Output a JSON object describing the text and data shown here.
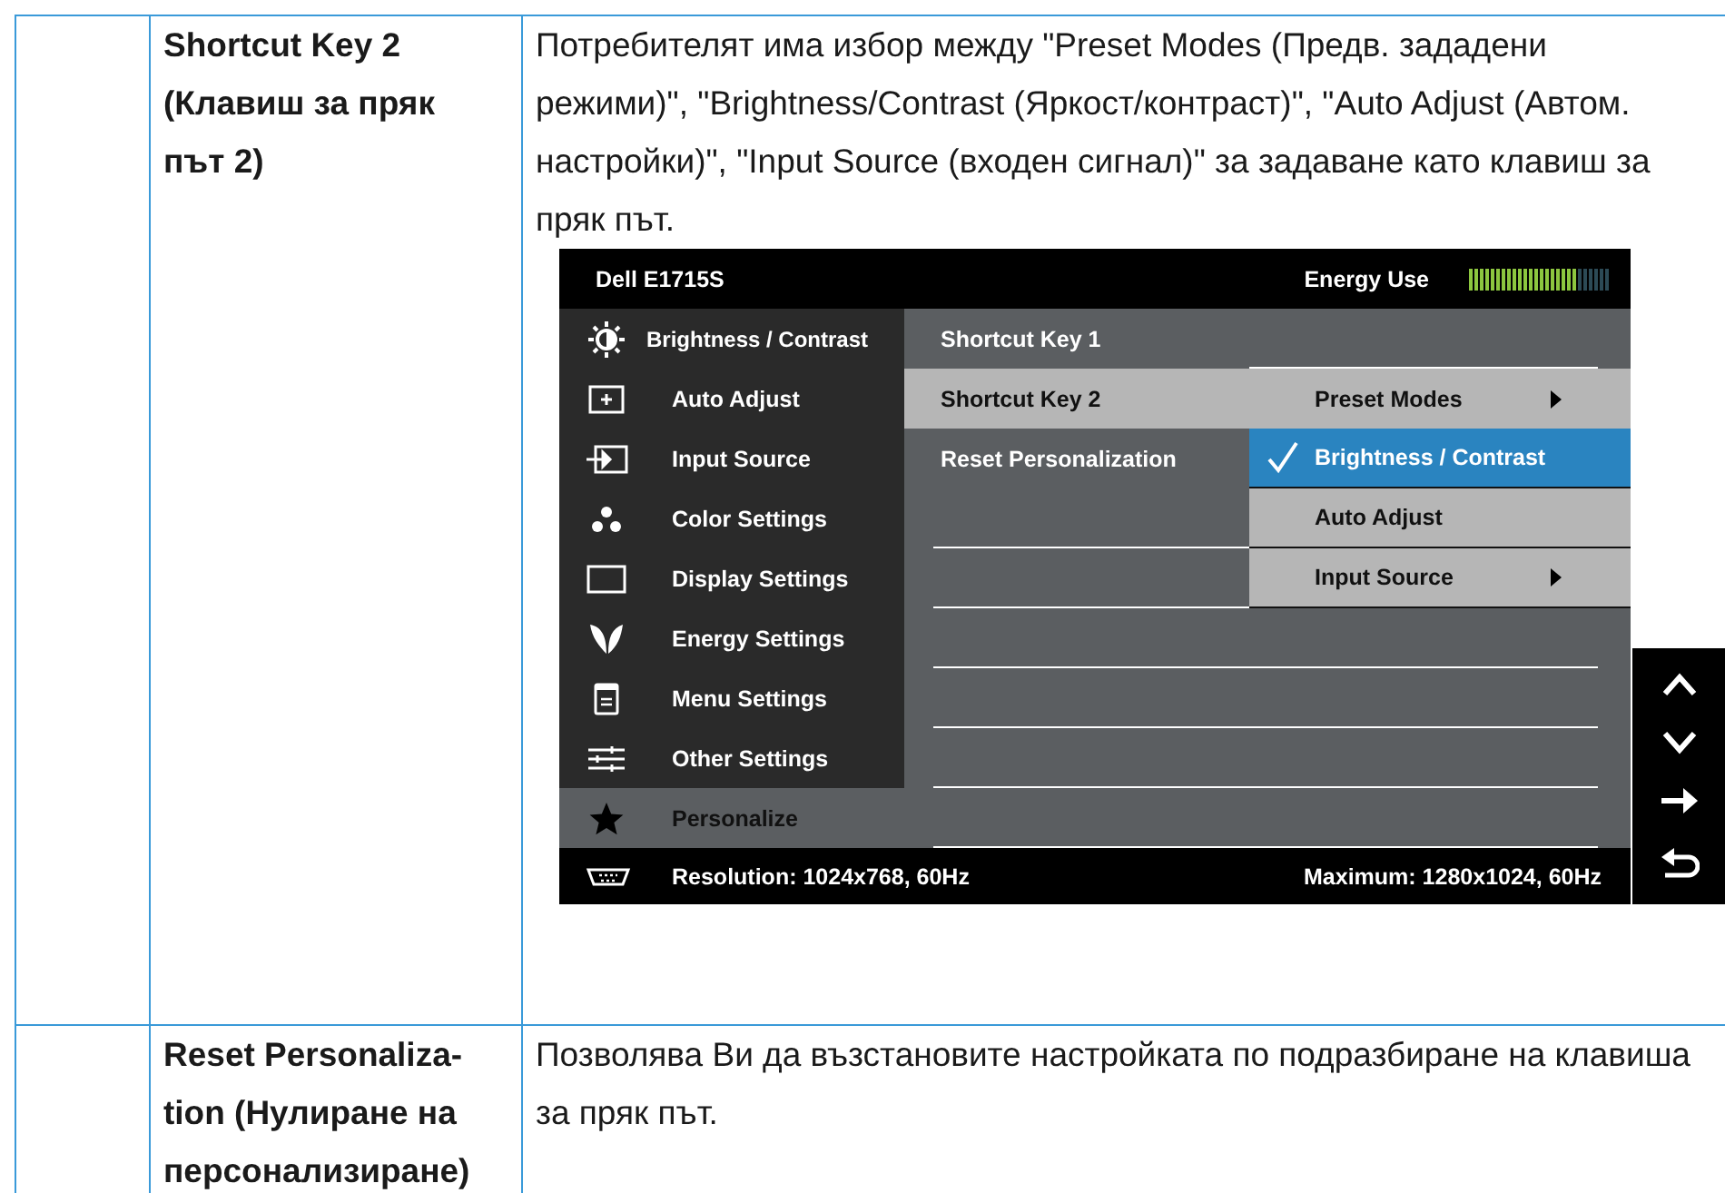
{
  "rows": [
    {
      "setting": "Shortcut Key 2 (Клавиш за пряк път 2)",
      "description": "Потребителят има избор между \"Preset Modes (Предв. зададени режими)\", \"Brightness/Contrast (Яркост/контраст)\", \"Auto Adjust (Автом. настройки)\", \"Input Source (входен сигнал)\" за задаване като клавиш за пряк път.",
      "osd": {
        "model": "Dell E1715S",
        "energy_label": "Energy Use",
        "energy_meter": {
          "level": 0.77
        },
        "menu": [
          {
            "label": "Brightness / Contrast",
            "selected": false
          },
          {
            "label": "Auto Adjust",
            "selected": false
          },
          {
            "label": "Input Source",
            "selected": false
          },
          {
            "label": "Color Settings",
            "selected": false
          },
          {
            "label": "Display Settings",
            "selected": false
          },
          {
            "label": "Energy Settings",
            "selected": false
          },
          {
            "label": "Menu Settings",
            "selected": false
          },
          {
            "label": "Other Settings",
            "selected": false
          },
          {
            "label": "Personalize",
            "selected": true
          }
        ],
        "submenu": [
          {
            "label": "Shortcut Key 1",
            "selected": false
          },
          {
            "label": "Shortcut Key 2",
            "selected": true
          },
          {
            "label": "Reset Personalization",
            "selected": false
          }
        ],
        "options": [
          {
            "label": "Preset Modes",
            "checked": false,
            "selected": false,
            "has_submenu": true
          },
          {
            "label": "Brightness / Contrast",
            "checked": true,
            "selected": true,
            "has_submenu": false
          },
          {
            "label": "Auto Adjust",
            "checked": false,
            "selected": false,
            "has_submenu": false
          },
          {
            "label": "Input Source",
            "checked": false,
            "selected": false,
            "has_submenu": true
          }
        ],
        "resolution": "Resolution: 1024x768, 60Hz",
        "maximum": "Maximum: 1280x1024, 60Hz"
      }
    },
    {
      "setting": "Reset Personaliza-tion (Нулиране на персонализиране)",
      "description": "Позволява Ви да възстановите настройката по подразбиране на клавиша за пряк път."
    }
  ]
}
